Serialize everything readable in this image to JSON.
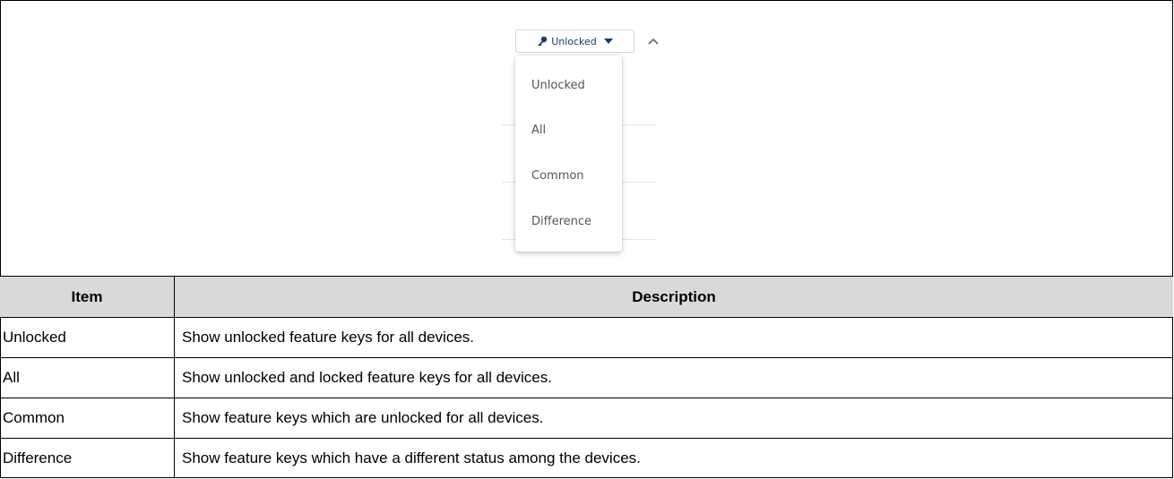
{
  "dropdown": {
    "selected_label": "Unlocked",
    "icons": {
      "key": "key-icon",
      "caret": "caret-down-icon",
      "collapse": "chevron-up-icon"
    },
    "options": [
      "Unlocked",
      "All",
      "Common",
      "Difference"
    ],
    "accent_color": "#1b3a6b"
  },
  "table": {
    "headers": {
      "item": "Item",
      "description": "Description"
    },
    "rows": [
      {
        "item": "Unlocked",
        "description": "Show unlocked feature keys for all devices."
      },
      {
        "item": "All",
        "description": "Show unlocked and locked feature keys for all devices."
      },
      {
        "item": "Common",
        "description": "Show feature keys which are unlocked for all devices."
      },
      {
        "item": "Difference",
        "description": "Show feature keys which have a different status among the devices."
      }
    ],
    "header_bg": "#d9d9d9"
  }
}
